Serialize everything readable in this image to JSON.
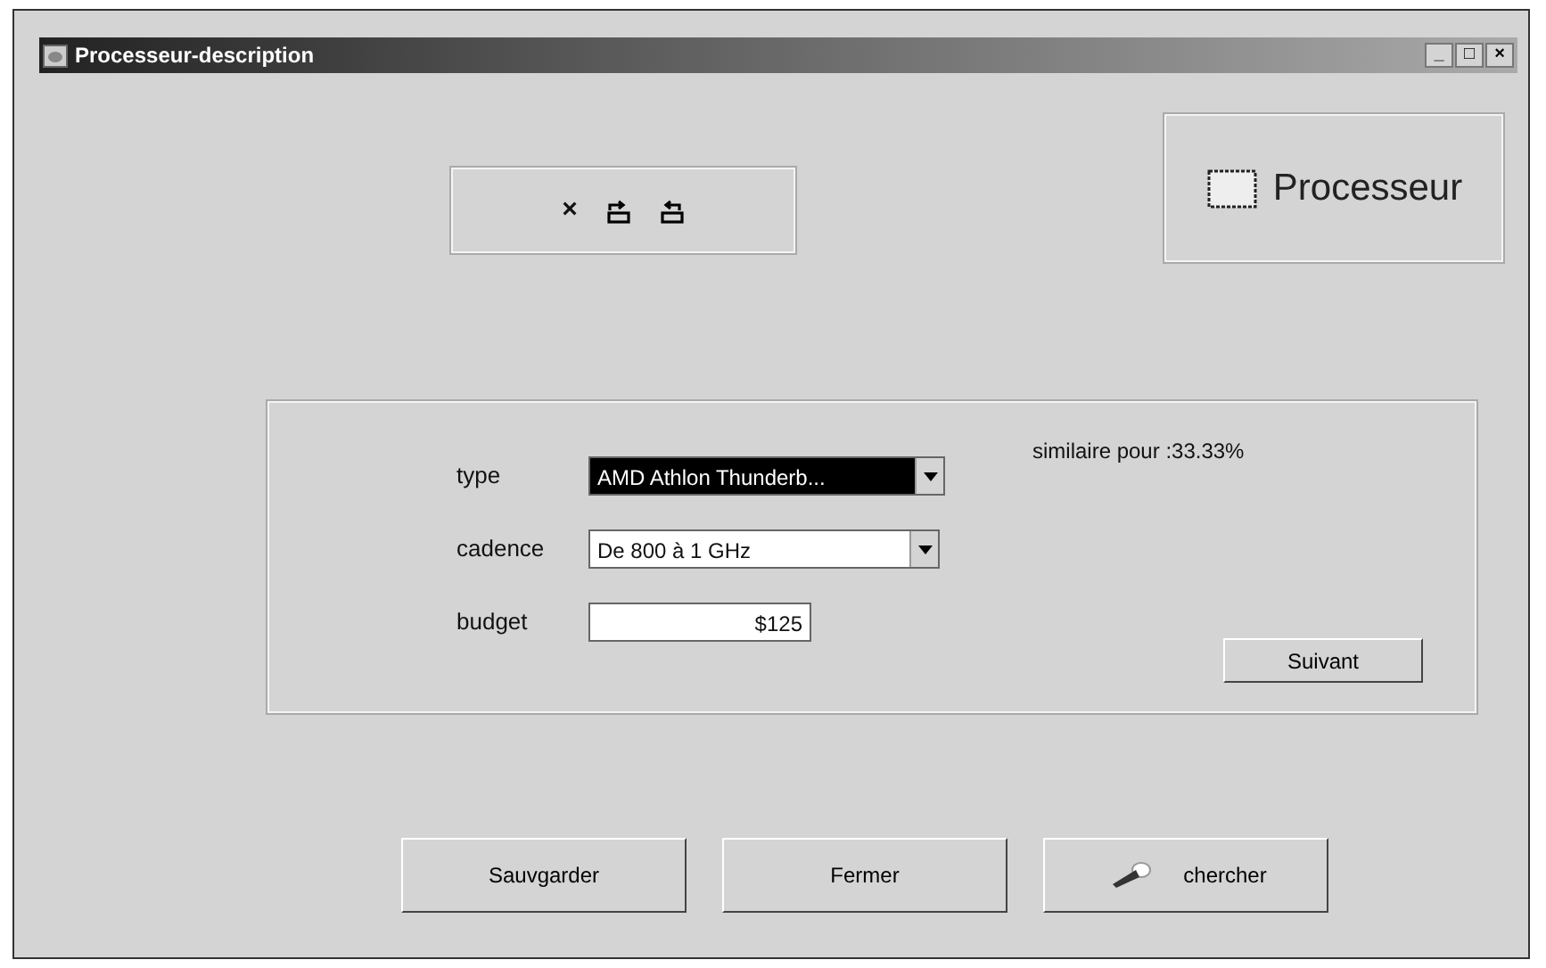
{
  "window": {
    "title": "Processeur-description",
    "controls": [
      "_",
      "□",
      "×"
    ]
  },
  "toolbar": {
    "tools": [
      "×"
    ]
  },
  "category": {
    "label": "Processeur"
  },
  "form": {
    "similarity": "similaire pour :33.33%",
    "fields": [
      {
        "label": "type",
        "kind": "combo",
        "value": "AMD Athlon Thunderb...",
        "highlighted": true
      },
      {
        "label": "cadence",
        "kind": "combo",
        "value": "De 800 à 1 GHz",
        "highlighted": false
      },
      {
        "label": "budget",
        "kind": "text",
        "value": "$125",
        "highlighted": false
      }
    ],
    "next_button": "Suivant"
  },
  "buttons": [
    {
      "label": "Sauvgarder",
      "kind": "plain"
    },
    {
      "label": "Fermer",
      "kind": "plain"
    },
    {
      "label": "chercher",
      "kind": "search"
    }
  ]
}
